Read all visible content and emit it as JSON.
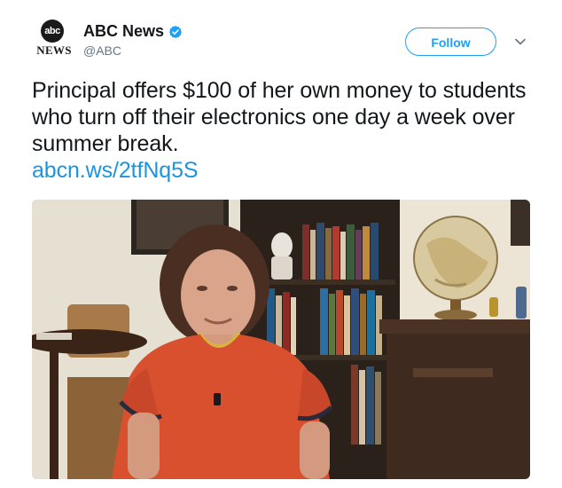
{
  "account": {
    "avatar_logo_text": "abc",
    "avatar_news_text": "NEWS",
    "display_name": "ABC News",
    "verified": true,
    "handle": "@ABC"
  },
  "actions": {
    "follow_label": "Follow",
    "menu_icon": "chevron-down-icon"
  },
  "tweet": {
    "text": "Principal offers $100 of her own money to students who turn off their electronics one day a week over summer break.",
    "link": "abcn.ws/2tfNq5S"
  },
  "colors": {
    "accent": "#1da1f2",
    "link": "#1b95e0",
    "handle": "#657786",
    "text": "#14171a"
  }
}
